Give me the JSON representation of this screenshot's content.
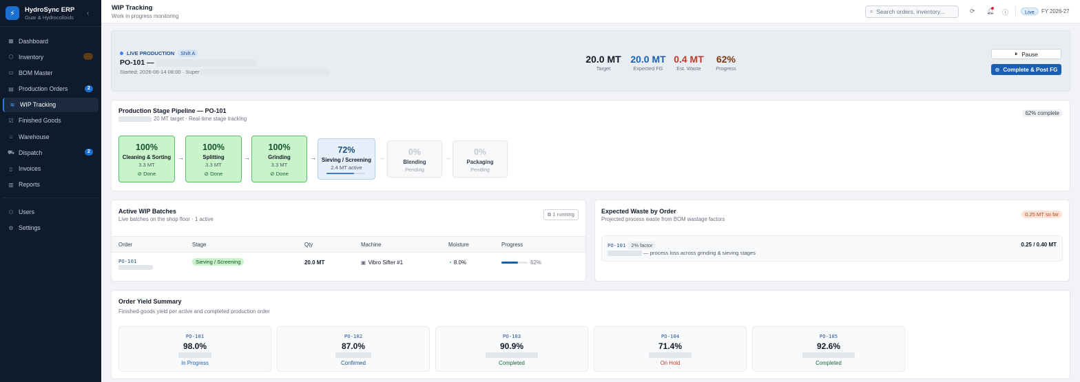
{
  "sidebar": {
    "brand_name": "HydroSync ERP",
    "brand_sub": "Guar & Hydrocolloids",
    "items": [
      {
        "label": "Dashboard",
        "icon": "grid-icon"
      },
      {
        "label": "Inventory",
        "icon": "box-icon",
        "badge": ""
      },
      {
        "label": "BOM Master",
        "icon": "book-icon"
      },
      {
        "label": "Production Orders",
        "icon": "factory-icon",
        "badge": "2"
      },
      {
        "label": "WIP Tracking",
        "icon": "layers-icon",
        "active": true
      },
      {
        "label": "Finished Goods",
        "icon": "check-box-icon"
      },
      {
        "label": "Warehouse",
        "icon": "warehouse-icon"
      },
      {
        "label": "Dispatch",
        "icon": "truck-icon",
        "badge": "2"
      },
      {
        "label": "Invoices",
        "icon": "document-icon"
      },
      {
        "label": "Reports",
        "icon": "bar-chart-icon"
      },
      {
        "label": "Users",
        "icon": "users-icon"
      },
      {
        "label": "Settings",
        "icon": "gear-icon"
      }
    ]
  },
  "header": {
    "title": "WIP Tracking",
    "subtitle": "Work in progress monitoring",
    "search_placeholder": "Search orders, inventory...",
    "live": "Live",
    "fy": "FY 2026-27"
  },
  "live": {
    "tag": "LIVE PRODUCTION",
    "shift": "Shift A",
    "po": "PO-101 —",
    "started": "Started: 2026-06-14 08:00 · Super",
    "kpis": [
      {
        "value": "20.0 MT",
        "label": "Target",
        "color": "#111827"
      },
      {
        "value": "20.0 MT",
        "label": "Expected FG",
        "color": "#1a5fb4"
      },
      {
        "value": "0.4 MT",
        "label": "Est. Waste",
        "color": "#c0392b"
      },
      {
        "value": "62%",
        "label": "Progress",
        "color": "#7c3a12"
      }
    ],
    "pause_label": "Pause",
    "post_label": "Complete & Post FG"
  },
  "pipeline": {
    "title": "Production Stage Pipeline — PO-101",
    "subtitle": "20 MT target · Real-time stage tracking",
    "complete": "62% complete",
    "stages": [
      {
        "pct": "100%",
        "name": "Cleaning & Sorting",
        "qty": "3.3 MT",
        "status": "Done"
      },
      {
        "pct": "100%",
        "name": "Splitting",
        "qty": "3.3 MT",
        "status": "Done"
      },
      {
        "pct": "100%",
        "name": "Grinding",
        "qty": "3.3 MT",
        "status": "Done"
      },
      {
        "pct": "72%",
        "name": "Sieving / Screening",
        "qty": "2.4 MT active",
        "progress": 0.72
      },
      {
        "pct": "0%",
        "name": "Blending",
        "qty": "Pending"
      },
      {
        "pct": "0%",
        "name": "Packaging",
        "qty": "Pending"
      }
    ]
  },
  "wip": {
    "title": "Active WIP Batches",
    "subtitle": "Live batches on the shop floor · 1 active",
    "running": "1 running",
    "columns": [
      "Order",
      "Stage",
      "Qty",
      "Machine",
      "Moisture",
      "Progress"
    ],
    "row": {
      "order": "PO-101",
      "stage": "Sieving / Screening",
      "qty": "20.0 MT",
      "machine": "Vibro Sifter #1",
      "moisture": "8.0%",
      "progress": "62%",
      "progress_value": 0.62
    }
  },
  "waste": {
    "title": "Expected Waste by Order",
    "subtitle": "Projected process waste from BOM wastage factors",
    "pill": "0.25 MT so far",
    "order": "PO-101",
    "factor": "2% factor",
    "desc": "— process loss across grinding & sieving stages",
    "value": "0.25 / 0.40 MT"
  },
  "yield": {
    "title": "Order Yield Summary",
    "subtitle": "Finished-goods yield per active and completed production order",
    "orders": [
      {
        "po": "PO-101",
        "pct": "98.0%",
        "status": "In Progress",
        "color": "#1a5fb4"
      },
      {
        "po": "PO-102",
        "pct": "87.0%",
        "status": "Confirmed",
        "color": "#1d4f8f"
      },
      {
        "po": "PO-103",
        "pct": "90.9%",
        "status": "Completed",
        "color": "#166534"
      },
      {
        "po": "PO-104",
        "pct": "71.4%",
        "status": "On Hold",
        "color": "#c0392b"
      },
      {
        "po": "PO-105",
        "pct": "92.6%",
        "status": "Completed",
        "color": "#166534"
      }
    ]
  }
}
